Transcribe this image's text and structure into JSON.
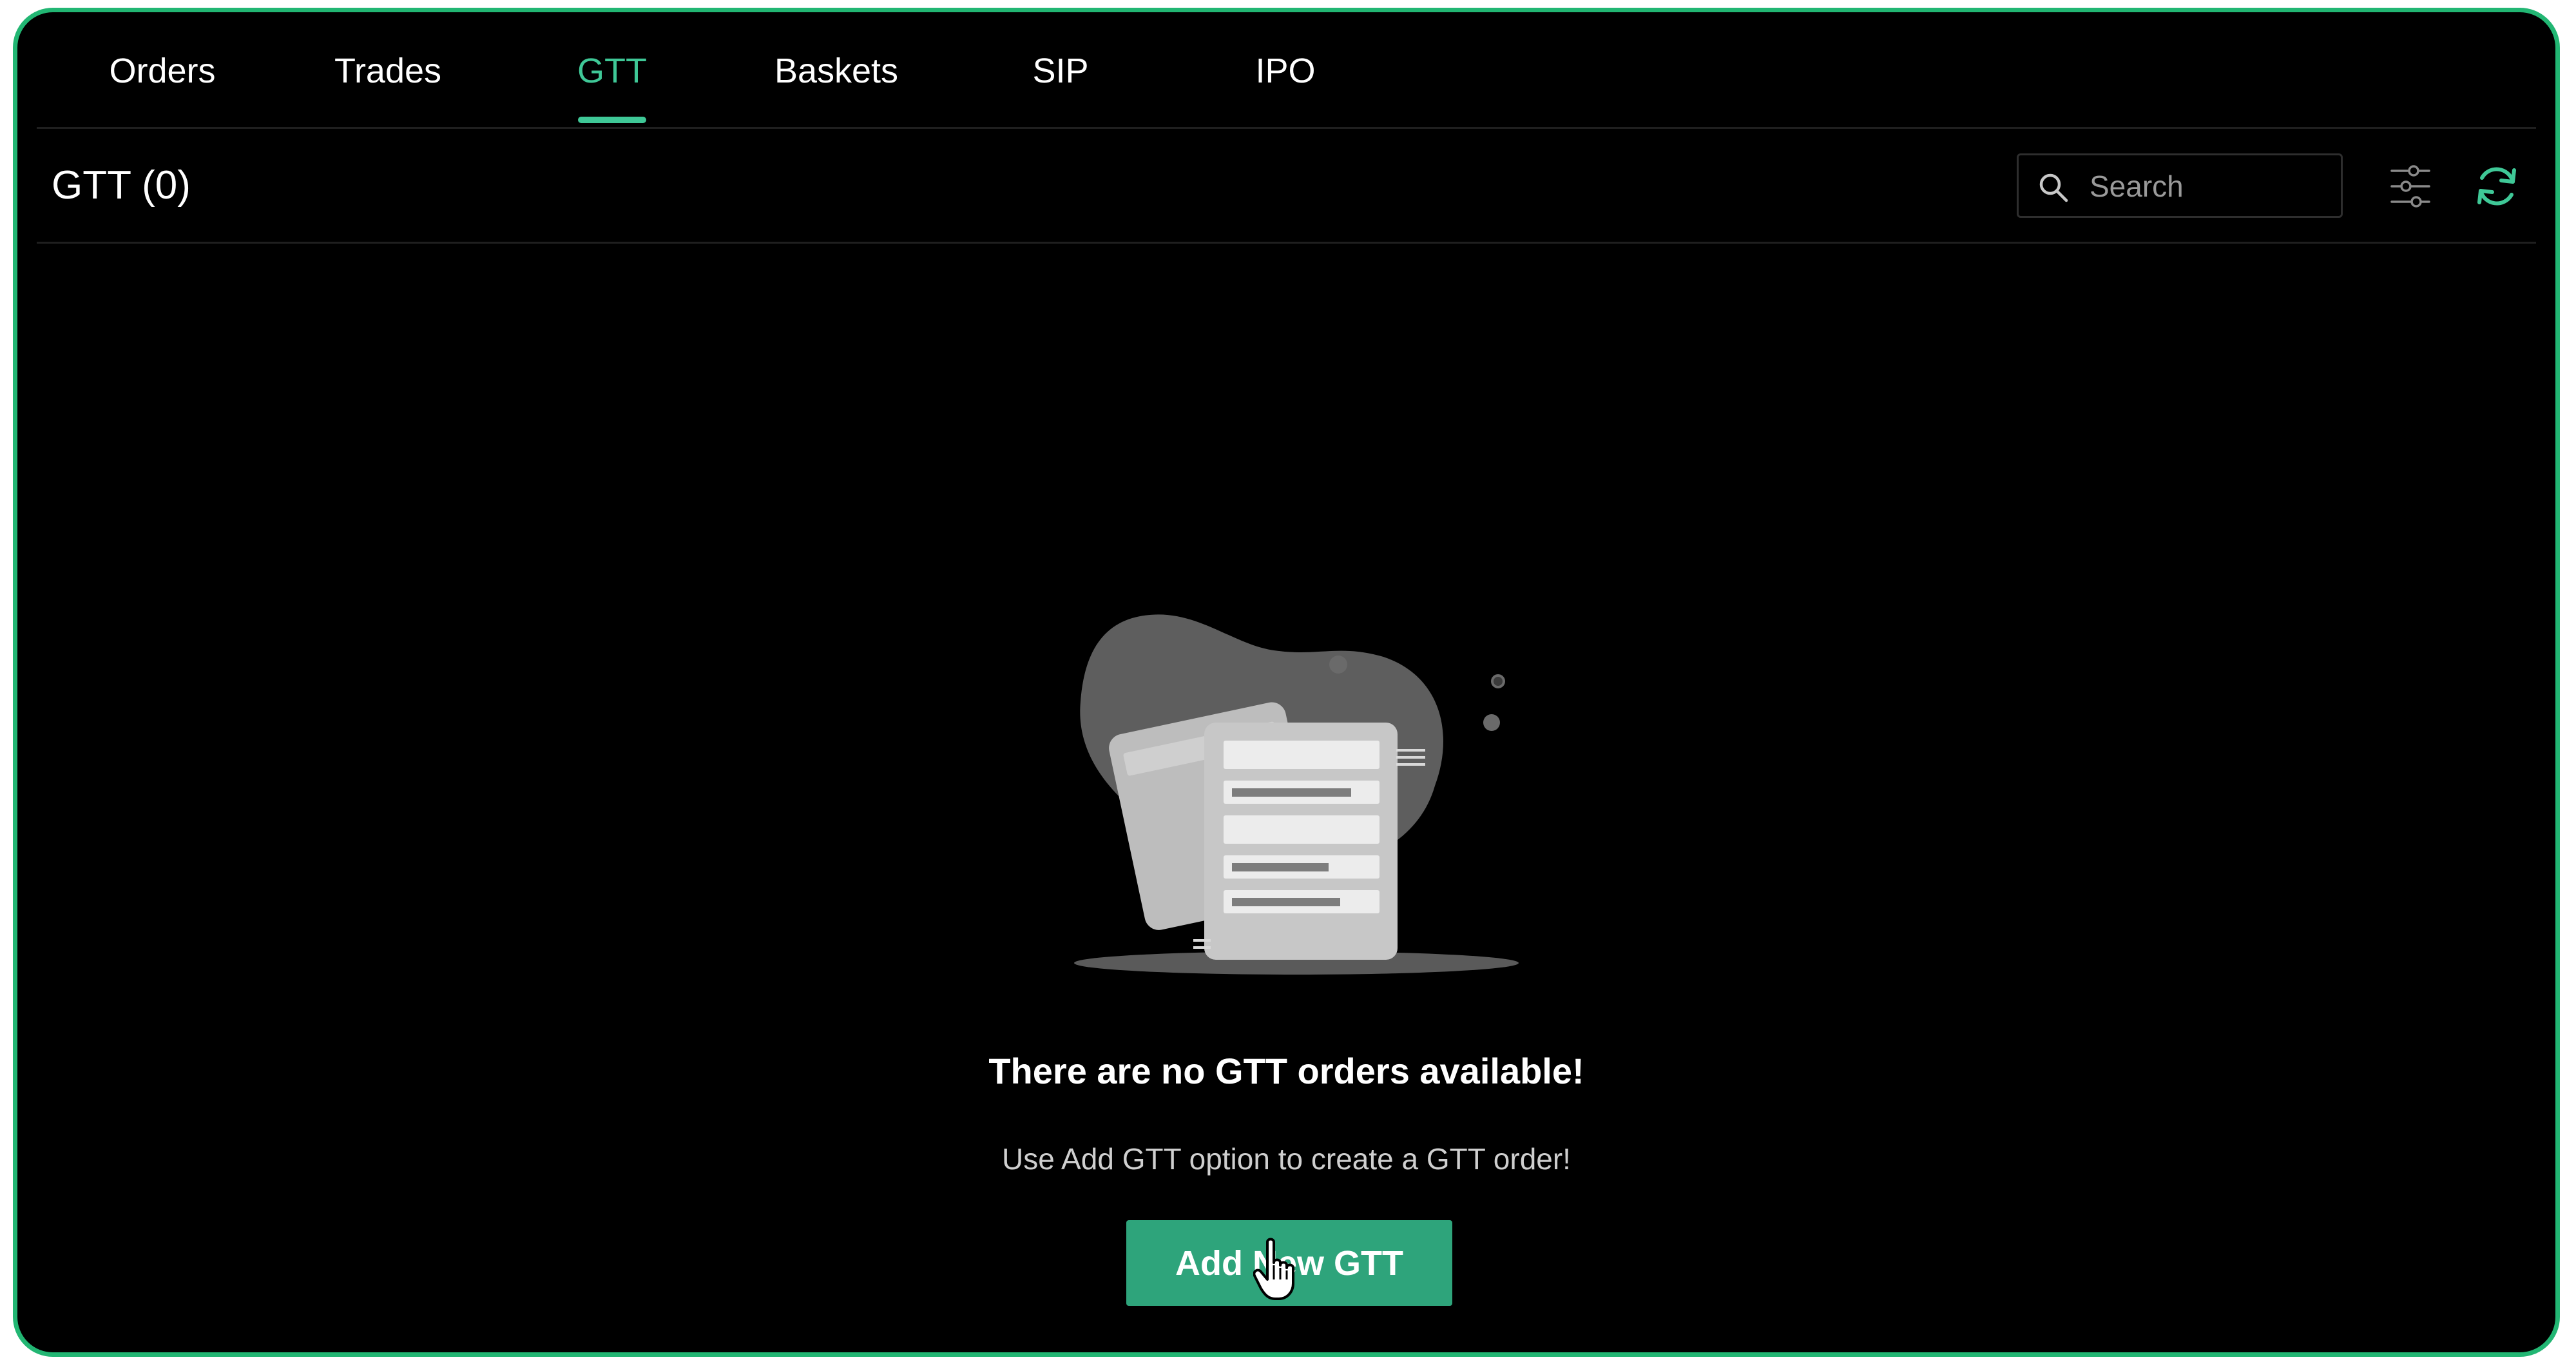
{
  "tabs": [
    {
      "label": "Orders",
      "active": false
    },
    {
      "label": "Trades",
      "active": false
    },
    {
      "label": "GTT",
      "active": true
    },
    {
      "label": "Baskets",
      "active": false
    },
    {
      "label": "SIP",
      "active": false
    },
    {
      "label": "IPO",
      "active": false
    }
  ],
  "header": {
    "title": "GTT (0)",
    "search_placeholder": "Search",
    "search_value": ""
  },
  "icons": {
    "search": "search-icon",
    "filter": "sliders-icon",
    "refresh": "refresh-icon",
    "cursor": "pointer-cursor-icon",
    "empty": "document-stack-illustration"
  },
  "empty_state": {
    "title": "There are no GTT orders available!",
    "subtitle": "Use Add GTT option to create a GTT order!",
    "button_label": "Add New GTT"
  },
  "colors": {
    "accent": "#3fc897",
    "button": "#2ea47b",
    "frame_border": "#22b673",
    "background": "#000000"
  }
}
